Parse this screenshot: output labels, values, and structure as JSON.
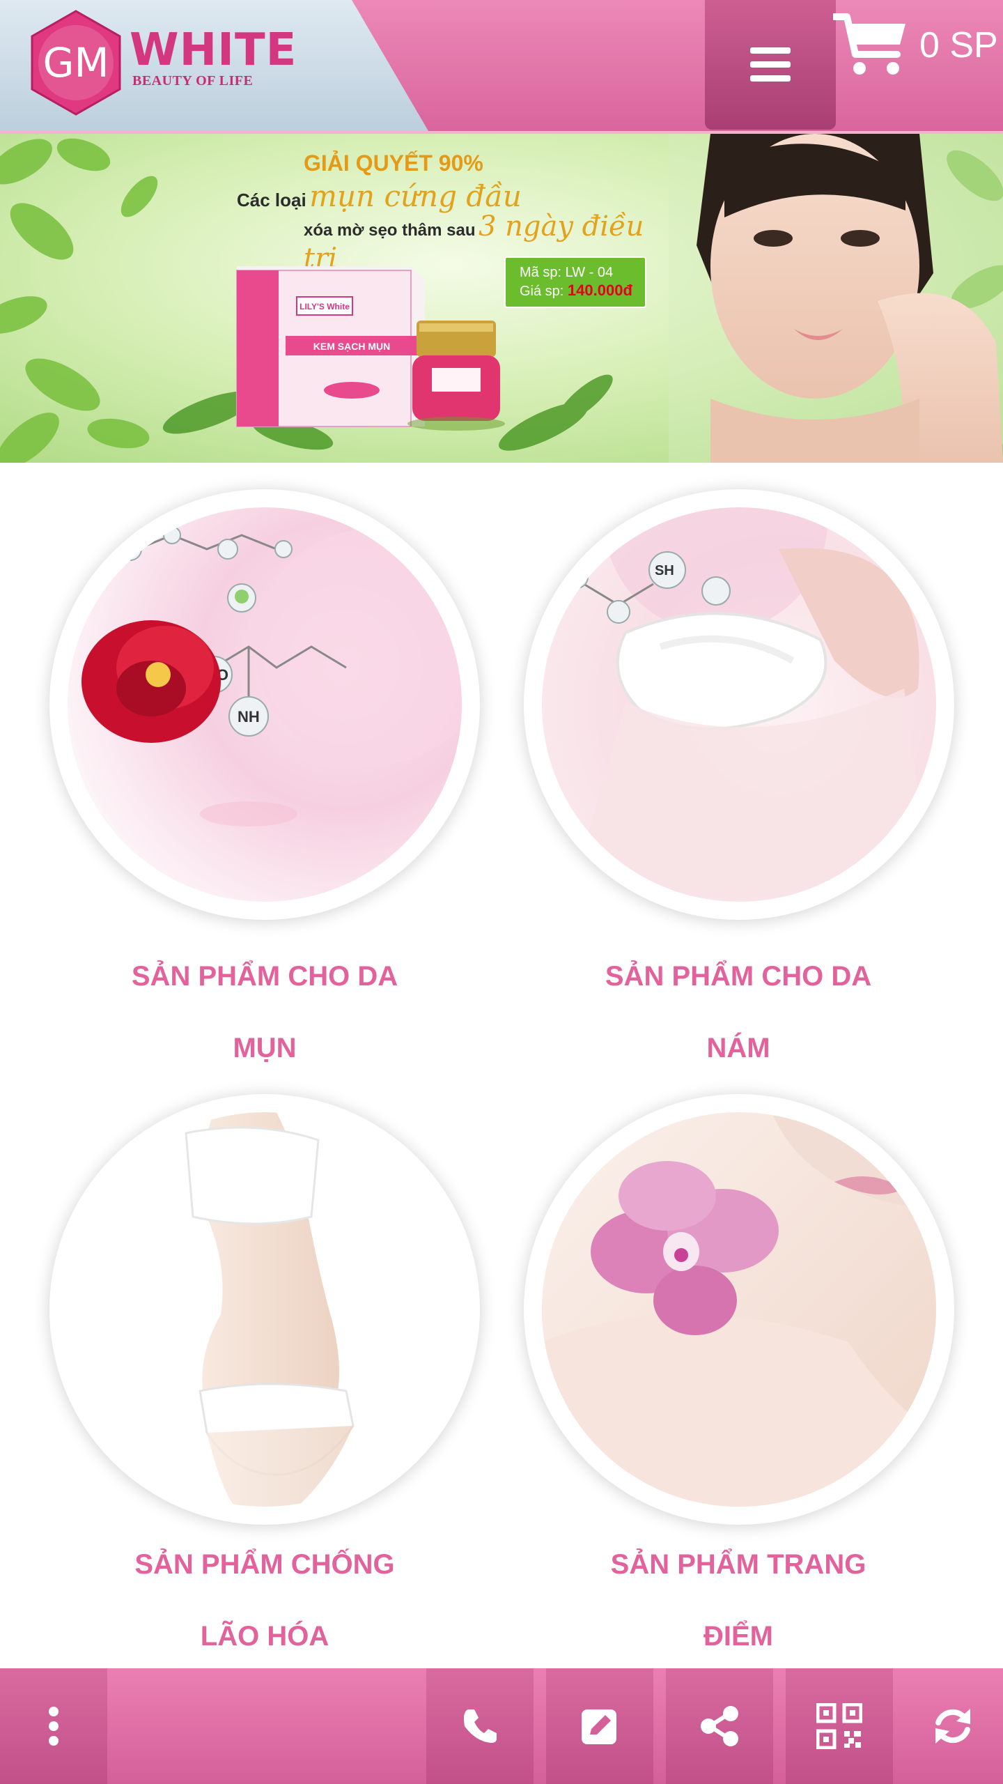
{
  "header": {
    "logo_monogram": "GM",
    "logo_main": "WHITE",
    "logo_tagline": "BEAUTY OF LIFE",
    "cart_count": "0 SP",
    "menu_icon": "hamburger-icon",
    "cart_icon": "cart-icon"
  },
  "banner": {
    "headline_1": "GIẢI QUYẾT 90%",
    "headline_2_prefix": "Các loại",
    "headline_2_script": "mụn cứng đầu",
    "headline_3_prefix": "xóa mờ sẹo thâm sau",
    "headline_3_script": "3 ngày điều trị",
    "product_code_label": "Mã sp: LW - 04",
    "price_label": "Giá sp:",
    "price_value": "140.000đ",
    "box_brand": "LILY'S White",
    "box_product": "KEM SẠCH MỤN"
  },
  "categories": [
    {
      "line1": "SẢN PHẨM CHO DA",
      "line2": "MỤN"
    },
    {
      "line1": "SẢN PHẨM CHO DA",
      "line2": "NÁM"
    },
    {
      "line1": "SẢN PHẨM CHỐNG",
      "line2": "LÃO HÓA"
    },
    {
      "line1": "SẢN PHẨM TRANG",
      "line2": "ĐIỂM"
    }
  ],
  "bottom_bar": {
    "icons": [
      "more-vertical-icon",
      "phone-icon",
      "edit-icon",
      "share-icon",
      "qr-code-icon",
      "refresh-icon"
    ]
  },
  "colors": {
    "header_pink": "#e27aad",
    "accent_pink": "#e2629c",
    "logo_pink": "#d2377f",
    "price_green": "#6bbd2e",
    "price_red": "#e5001f"
  }
}
